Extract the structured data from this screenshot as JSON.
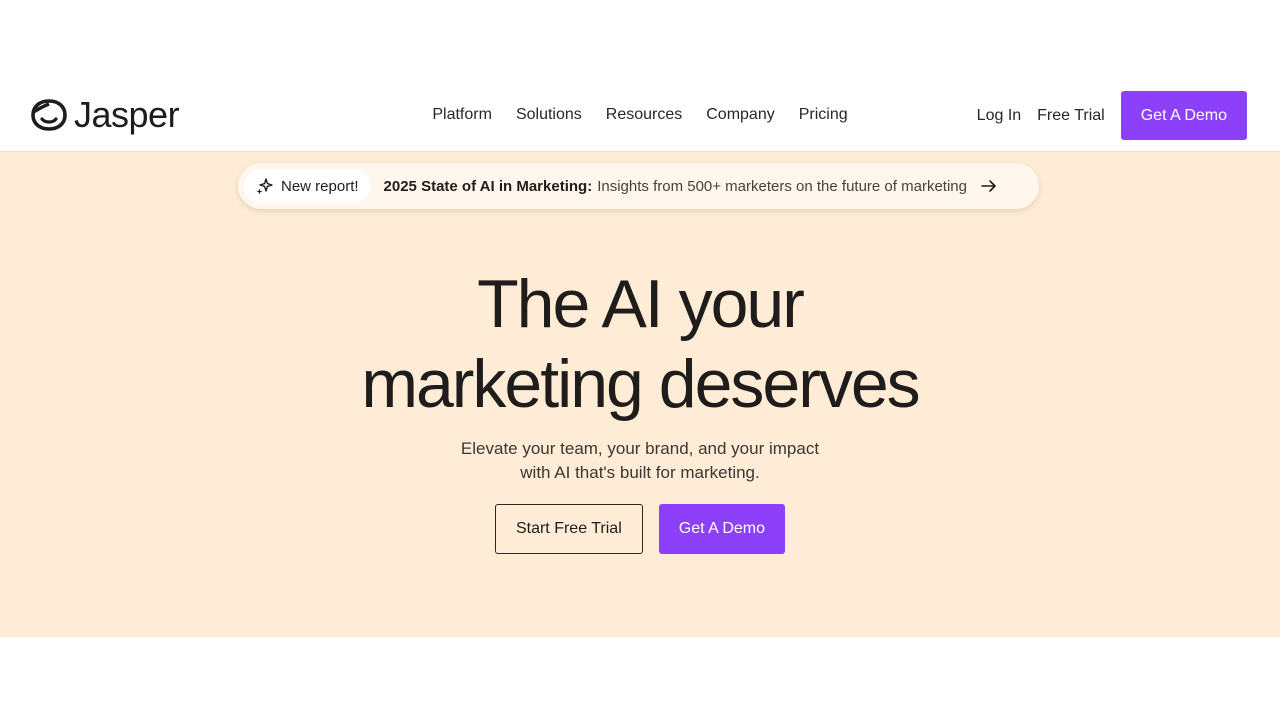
{
  "brand": {
    "name": "Jasper",
    "logo_icon": "jasper-face-icon"
  },
  "nav": {
    "links": [
      "Platform",
      "Solutions",
      "Resources",
      "Company",
      "Pricing"
    ],
    "login": "Log In",
    "free_trial": "Free Trial",
    "demo": "Get A Demo"
  },
  "announcement": {
    "badge_icon": "sparkle-icon",
    "badge": "New report!",
    "headline": "2025 State of AI in Marketing:",
    "detail": "Insights from 500+ marketers on the future of marketing",
    "arrow_icon": "arrow-right-icon"
  },
  "hero": {
    "title_line1": "The AI your",
    "title_line2": "marketing deserves",
    "subtitle_line1": "Elevate your team, your brand, and your impact",
    "subtitle_line2": "with AI that's built for marketing.",
    "cta_secondary": "Start Free Trial",
    "cta_primary": "Get A Demo"
  },
  "colors": {
    "accent": "#8c40f9",
    "hero_background": "#feecd6",
    "text": "#1f1d1b"
  }
}
